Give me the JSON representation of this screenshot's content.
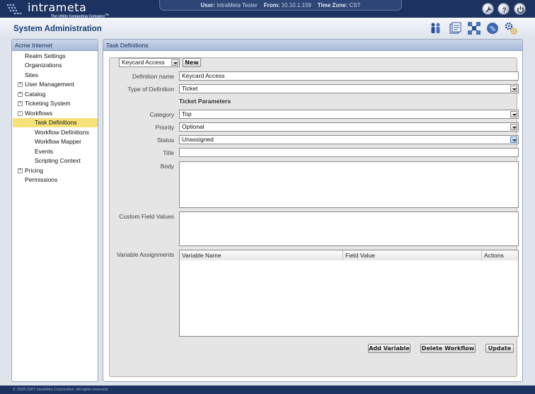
{
  "app": {
    "logo_text": "intrameta",
    "logo_tagline": "The Utility Computing Company",
    "logo_tm": "TM"
  },
  "userbar": {
    "user_label": "User:",
    "user_value": "IntraMeta Tester",
    "from_label": "From:",
    "from_value": "10.10.1.159",
    "tz_label": "Time Zone:",
    "tz_value": "CST"
  },
  "top_icons": [
    "wrench-icon",
    "help-icon",
    "power-icon"
  ],
  "page_title": "System Administration",
  "app_icons": [
    "users-icon",
    "documents-icon",
    "network-icon",
    "globe-icon",
    "settings-gears-icon"
  ],
  "sidebar": {
    "header": "Acme Internet",
    "items": [
      {
        "label": "Realm Settings",
        "level": 0,
        "expander": ""
      },
      {
        "label": "Organizations",
        "level": 0,
        "expander": ""
      },
      {
        "label": "Sites",
        "level": 0,
        "expander": ""
      },
      {
        "label": "User Management",
        "level": 0,
        "expander": "+"
      },
      {
        "label": "Catalog",
        "level": 0,
        "expander": "+"
      },
      {
        "label": "Ticketing System",
        "level": 0,
        "expander": "+"
      },
      {
        "label": "Workflows",
        "level": 0,
        "expander": "-"
      },
      {
        "label": "Task Definitions",
        "level": 1,
        "expander": "",
        "selected": true
      },
      {
        "label": "Workflow Definitions",
        "level": 1,
        "expander": ""
      },
      {
        "label": "Workflow Mapper",
        "level": 1,
        "expander": ""
      },
      {
        "label": "Events",
        "level": 1,
        "expander": ""
      },
      {
        "label": "Scripting Context",
        "level": 1,
        "expander": ""
      },
      {
        "label": "Pricing",
        "level": 0,
        "expander": "+"
      },
      {
        "label": "Permissions",
        "level": 0,
        "expander": ""
      }
    ]
  },
  "main": {
    "header": "Task Definitions",
    "selector_value": "Keycard Access",
    "new_button": "New",
    "definition_name_label": "Definition name",
    "definition_name_value": "Keycard Access",
    "type_label": "Type of Definition",
    "type_value": "Ticket",
    "section_heading": "Ticket Parameters",
    "category_label": "Category",
    "category_value": "Top",
    "priority_label": "Priority",
    "priority_value": "Optional",
    "status_label": "Status",
    "status_value": "Unassigned",
    "title_label": "Title",
    "title_value": "",
    "body_label": "Body",
    "custom_fields_label": "Custom Field Values",
    "variables_label": "Variable Assignments",
    "columns": [
      "Variable Name",
      "Field Value",
      "Actions"
    ],
    "add_variable_button": "Add Variable",
    "delete_workflow_button": "Delete Workflow",
    "update_button": "Update"
  },
  "footer": "© 2003-2007 IntraMeta Corporation.  All rights reserved."
}
